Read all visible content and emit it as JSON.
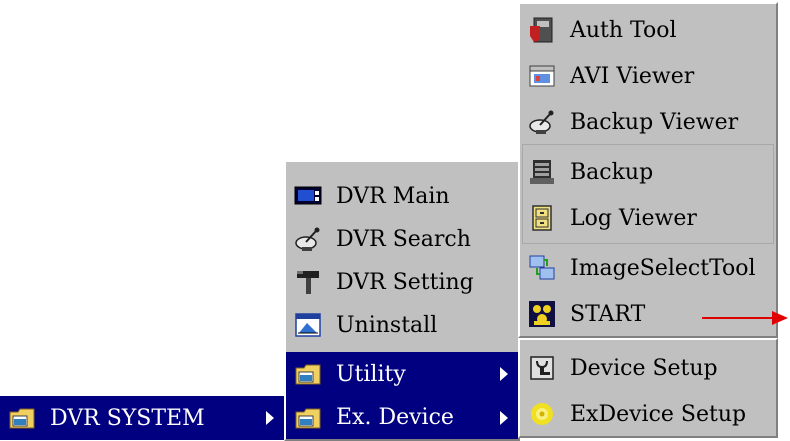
{
  "start_menu": {
    "item": {
      "label": "DVR SYSTEM",
      "icon": "program-group-icon"
    }
  },
  "dvr_system_menu": {
    "items": [
      {
        "label": "DVR Main",
        "icon": "monitor-icon"
      },
      {
        "label": "DVR Search",
        "icon": "satellite-dish-icon"
      },
      {
        "label": "DVR Setting",
        "icon": "hammer-icon"
      },
      {
        "label": "Uninstall",
        "icon": "uninstall-icon"
      },
      {
        "label": "Utility",
        "icon": "program-group-icon"
      },
      {
        "label": "Ex. Device",
        "icon": "program-group-icon"
      }
    ]
  },
  "utility_menu": {
    "items": [
      {
        "label": "Auth Tool",
        "icon": "auth-tool-icon"
      },
      {
        "label": "AVI Viewer",
        "icon": "avi-viewer-icon"
      },
      {
        "label": "Backup Viewer",
        "icon": "satellite-dish-icon"
      },
      {
        "label": "Backup",
        "icon": "server-icon"
      },
      {
        "label": "Log Viewer",
        "icon": "file-cabinet-icon"
      },
      {
        "label": "ImageSelectTool",
        "icon": "image-select-icon"
      },
      {
        "label": "START",
        "icon": "start-icon"
      }
    ]
  },
  "ex_device_menu": {
    "items": [
      {
        "label": "Device Setup",
        "icon": "device-setup-icon"
      },
      {
        "label": "ExDevice Setup",
        "icon": "exdevice-setup-icon"
      }
    ]
  },
  "colors": {
    "menu_bg": "#c0c0c0",
    "highlight": "#000080",
    "pointer_arrow": "#e00000"
  }
}
